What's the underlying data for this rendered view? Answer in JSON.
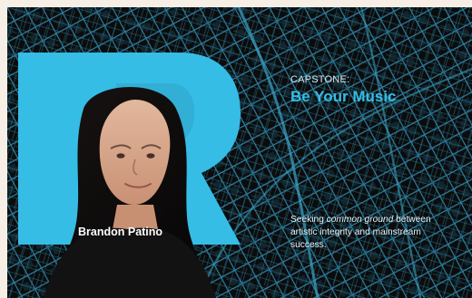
{
  "card": {
    "kicker": "CAPSTONE:",
    "title": "Be Your Music",
    "person_name": "Brandon Patino",
    "blurb_prefix": "Seeking ",
    "blurb_emphasis": "common ground",
    "blurb_suffix": " between artistic integrity and mainstream success."
  },
  "colors": {
    "accent_blue": "#35bde6",
    "map_lines": "#2b7fa1",
    "background": "#0b0b0b",
    "outer_background": "#f7efe6"
  },
  "icons": {
    "brand_letter_shape": "r-shape"
  }
}
